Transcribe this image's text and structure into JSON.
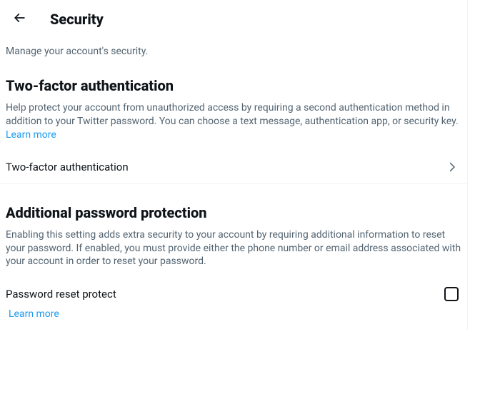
{
  "header": {
    "title": "Security"
  },
  "subtitle": "Manage your account's security.",
  "sections": {
    "twoFactor": {
      "title": "Two-factor authentication",
      "desc": "Help protect your account from unauthorized access by requiring a second authentication method in addition to your Twitter password. You can choose a text message, authentication app, or security key.",
      "learnMore": "Learn more",
      "rowLabel": "Two-factor authentication"
    },
    "additionalProtection": {
      "title": "Additional password protection",
      "desc": "Enabling this setting adds extra security to your account by requiring additional information to reset your password. If enabled, you must provide either the phone number or email address associated with your account in order to reset your password.",
      "checkboxLabel": "Password reset protect",
      "learnMore": "Learn more"
    }
  }
}
